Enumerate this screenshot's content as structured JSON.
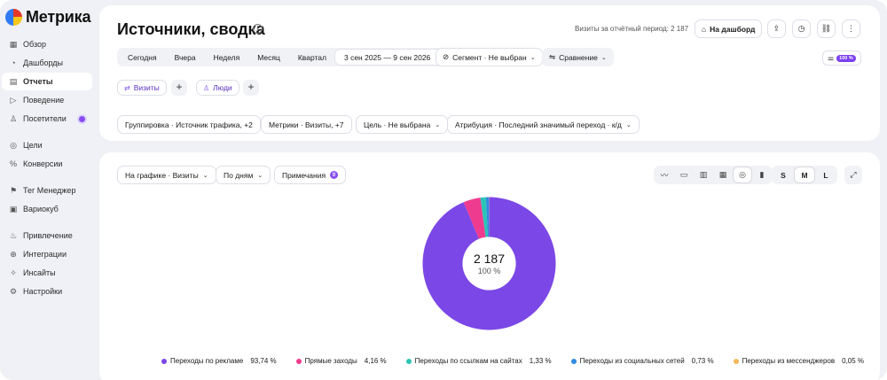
{
  "app": {
    "name": "Метрика"
  },
  "sidebar": {
    "items": [
      {
        "label": "Обзор",
        "icon": "grid-icon"
      },
      {
        "label": "Дашборды",
        "icon": "dashboard-icon"
      },
      {
        "label": "Отчеты",
        "icon": "reports-icon",
        "active": true
      },
      {
        "label": "Поведение",
        "icon": "play-icon"
      },
      {
        "label": "Посетители",
        "icon": "user-icon",
        "badge": true
      },
      {
        "label": "Цели",
        "icon": "target-icon"
      },
      {
        "label": "Конверсии",
        "icon": "percent-icon"
      },
      {
        "label": "Тег Менеджер",
        "icon": "tag-icon"
      },
      {
        "label": "Вариокуб",
        "icon": "cube-icon"
      },
      {
        "label": "Привлечение",
        "icon": "flame-icon"
      },
      {
        "label": "Интеграции",
        "icon": "integrations-icon"
      },
      {
        "label": "Инсайты",
        "icon": "magic-icon"
      },
      {
        "label": "Настройки",
        "icon": "gear-icon"
      }
    ]
  },
  "header": {
    "title": "Источники, сводка",
    "visits_period": "Визиты за отчётный период: 2 187",
    "dashboard_button": "На дашборд"
  },
  "period": {
    "options": [
      "Сегодня",
      "Вчера",
      "Неделя",
      "Месяц",
      "Квартал"
    ],
    "date_range": "3 сен 2025 — 9 сен 2026",
    "segment": "Сегмент · Не выбран",
    "comparison": "Сравнение",
    "sampling": "100 %"
  },
  "chips": {
    "visits": "Визиты",
    "people": "Люди"
  },
  "filters": {
    "grouping": "Группировка · Источник трафика, +2",
    "metrics": "Метрики · Визиты, +7",
    "goal": "Цель · Не выбрана",
    "attribution": "Атрибуция · Последний значимый переход · к/д"
  },
  "chart_controls": {
    "on_chart": "На графике · Визиты",
    "by_days": "По дням",
    "notes": "Примечания",
    "notes_count": "0",
    "sizes": [
      "S",
      "M",
      "L"
    ],
    "selected_size": "M"
  },
  "chart_data": {
    "type": "pie",
    "total_label": "2 187",
    "total_pct": "100 %",
    "series": [
      {
        "name": "Переходы по рекламе",
        "value": 93.74,
        "label": "93,74 %",
        "color": "#7b47e6"
      },
      {
        "name": "Прямые заходы",
        "value": 4.16,
        "label": "4,16 %",
        "color": "#ef3b8f"
      },
      {
        "name": "Переходы по ссылкам на сайтах",
        "value": 1.33,
        "label": "1,33 %",
        "color": "#2cc4b6"
      },
      {
        "name": "Переходы из социальных сетей",
        "value": 0.73,
        "label": "0,73 %",
        "color": "#2f8be0"
      },
      {
        "name": "Переходы из мессенджеров",
        "value": 0.05,
        "label": "0,05 %",
        "color": "#f4b85a"
      }
    ]
  }
}
